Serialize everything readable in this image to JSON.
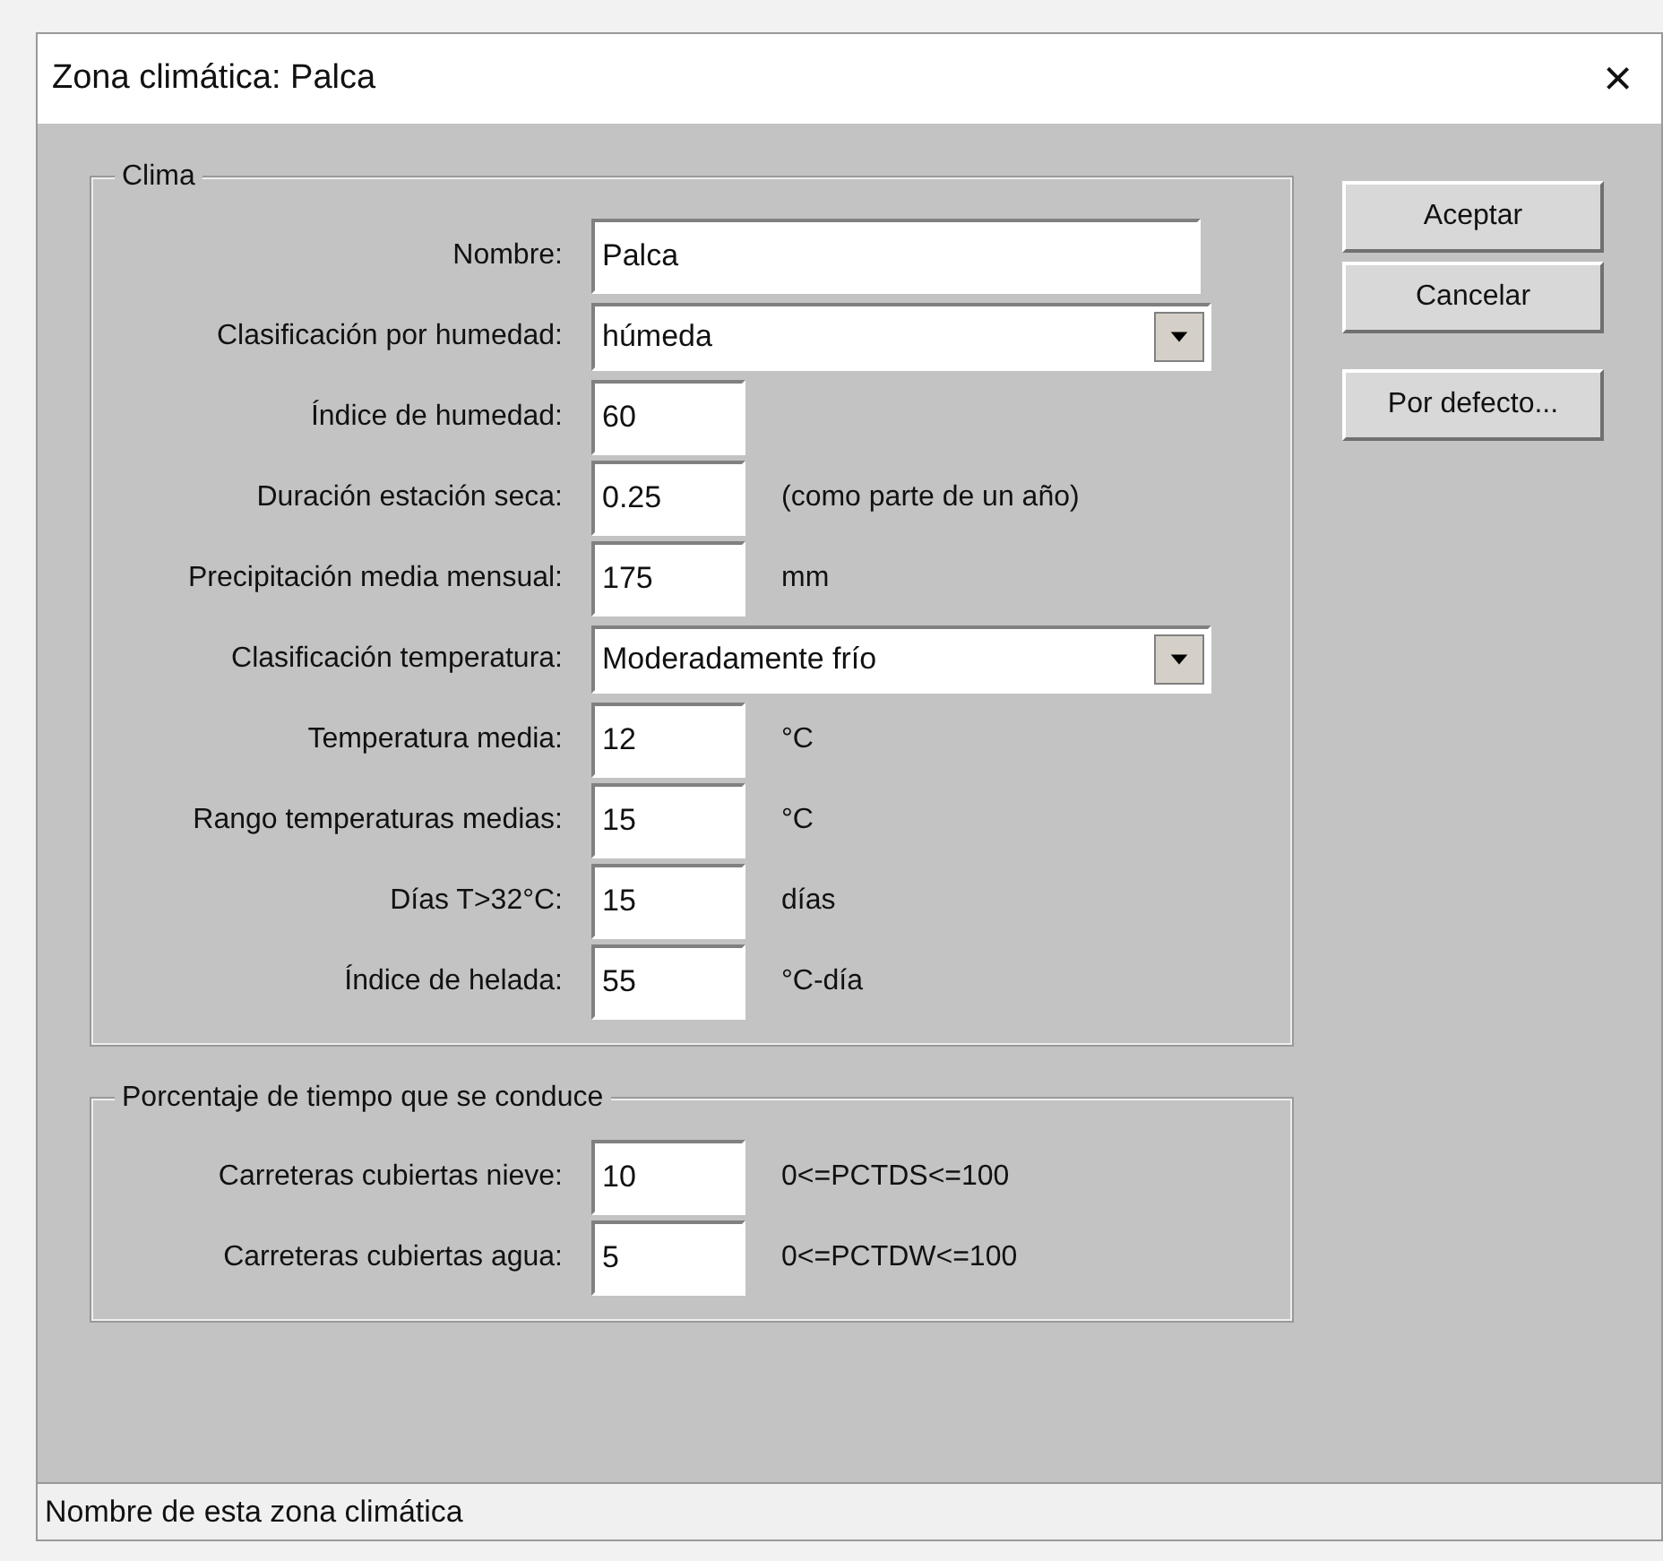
{
  "window": {
    "title": "Zona climática: Palca",
    "close": "×"
  },
  "groups": [
    {
      "title": "Clima",
      "rows": [
        {
          "kind": "wide",
          "label": "Nombre:",
          "value": "Palca"
        },
        {
          "kind": "select",
          "label": "Clasificación por humedad:",
          "value": "húmeda"
        },
        {
          "kind": "short",
          "label": "Índice de humedad:",
          "value": "60"
        },
        {
          "kind": "short",
          "label": "Duración estación seca:",
          "value": "0.25",
          "unit": "(como parte de un año)"
        },
        {
          "kind": "short",
          "label": "Precipitación media mensual:",
          "value": "175",
          "unit": "mm"
        },
        {
          "kind": "select",
          "label": "Clasificación temperatura:",
          "value": "Moderadamente frío"
        },
        {
          "kind": "short",
          "label": "Temperatura media:",
          "value": "12",
          "unit": "°C"
        },
        {
          "kind": "short",
          "label": "Rango temperaturas medias:",
          "value": "15",
          "unit": "°C"
        },
        {
          "kind": "short",
          "label": "Días T>32°C:",
          "value": "15",
          "unit": "días"
        },
        {
          "kind": "short",
          "label": "Índice de helada:",
          "value": "55",
          "unit": "°C-día"
        }
      ]
    },
    {
      "title": "Porcentaje de tiempo que se conduce",
      "rows": [
        {
          "kind": "short",
          "label": "Carreteras cubiertas nieve:",
          "value": "10",
          "unit": "0<=PCTDS<=100"
        },
        {
          "kind": "short",
          "label": "Carreteras cubiertas agua:",
          "value": "5",
          "unit": "0<=PCTDW<=100"
        }
      ]
    }
  ],
  "buttons": [
    "Aceptar",
    "Cancelar",
    "Por defecto..."
  ],
  "status_bar": "Nombre de esta zona climática"
}
